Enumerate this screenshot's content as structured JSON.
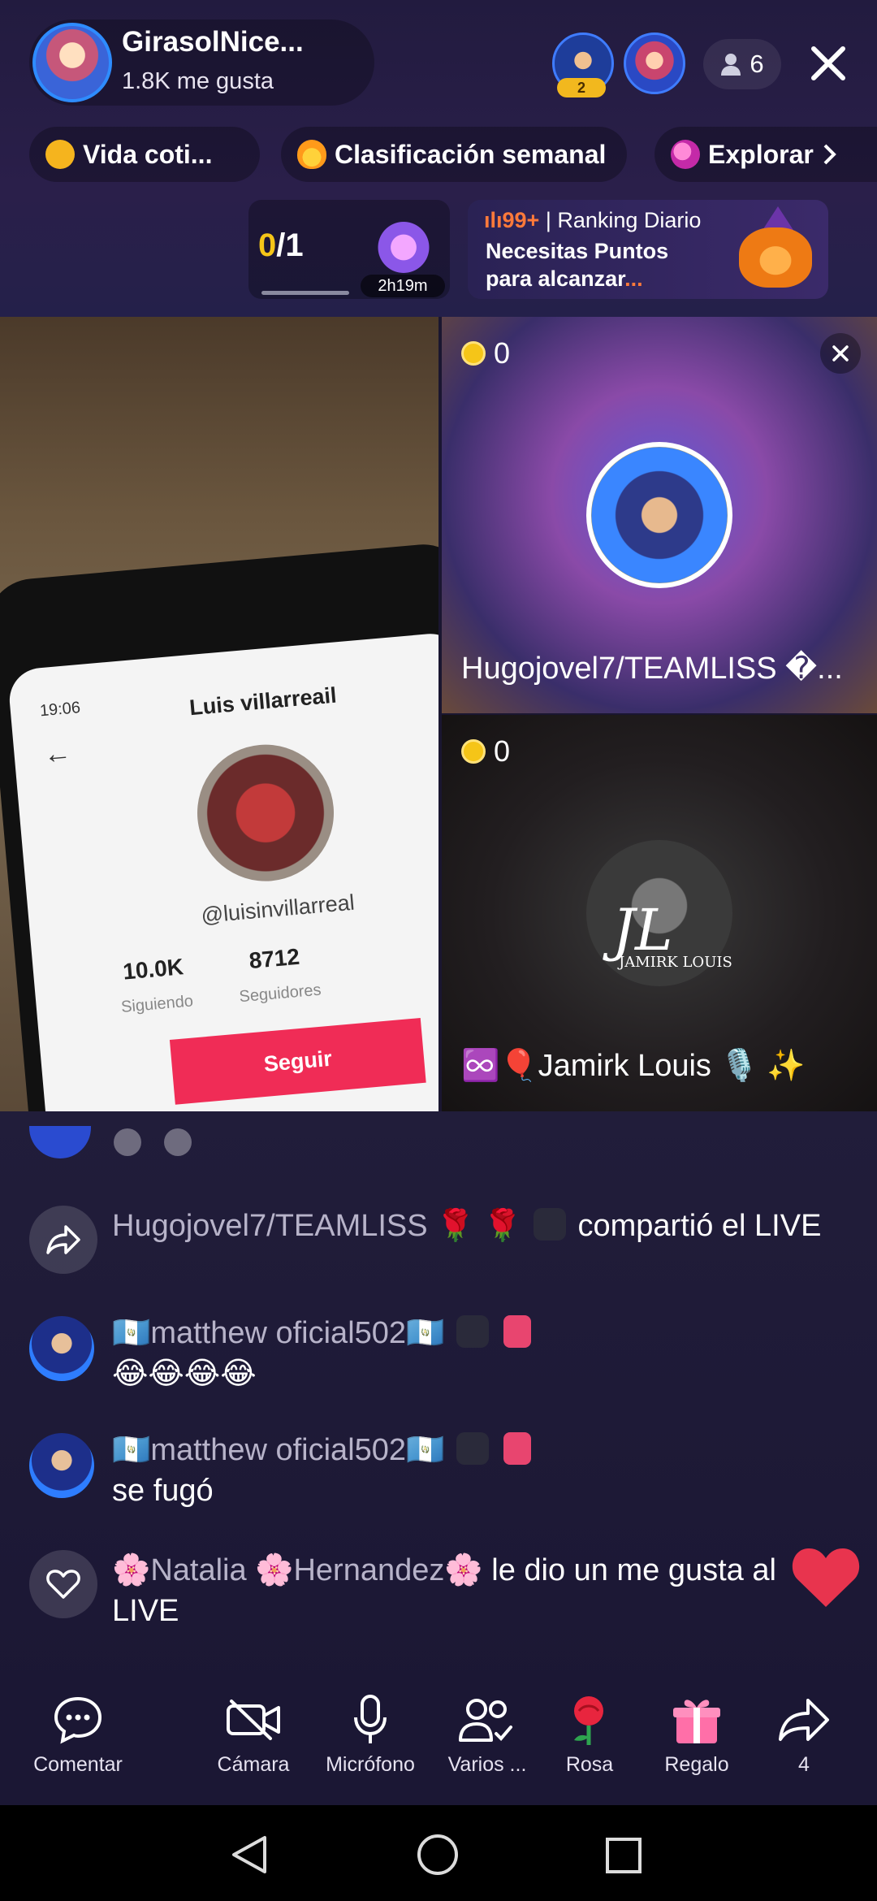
{
  "header": {
    "host_name": "GirasolNice...",
    "host_likes": "1.8K me gusta",
    "viewer_badge": "2",
    "viewer_count": "6"
  },
  "chips": [
    {
      "label": "Vida coti..."
    },
    {
      "label": "Clasificación semanal"
    },
    {
      "label": "Explorar"
    }
  ],
  "goal": {
    "current": "0",
    "total": "/1",
    "timer": "2h19m"
  },
  "ranking": {
    "badge": "99+",
    "title": "Ranking Diario",
    "line1": "Necesitas Puntos",
    "line2": "para alcanzar",
    "ellipsis": "..."
  },
  "main_video": {
    "phone_time": "19:06",
    "profile_name": "Luis villarreail",
    "profile_handle": "@luisinvillarreal",
    "following_count": "10.0K",
    "following_label": "Siguiendo",
    "followers_count": "8712",
    "followers_label": "Seguidores",
    "follow_button": "Seguir"
  },
  "cohosts": [
    {
      "name": "Hugojovel7/TEAMLISS �...",
      "score": "0"
    },
    {
      "name": "♾️🎈Jamirk Louis 🎙️ ✨",
      "score": "0",
      "logo_text": "JL",
      "logo_sub": "JAMIRK LOUIS"
    }
  ],
  "chat": [
    {
      "user": "Hugojovel7/TEAMLISS 🌹 🌹",
      "message": "compartió el LIVE",
      "type": "share"
    },
    {
      "user": "🇬🇹matthew oficial502🇬🇹",
      "message": "😂😂😂😂",
      "type": "comment"
    },
    {
      "user": "🇬🇹matthew oficial502🇬🇹",
      "message": "se fugó",
      "type": "comment"
    },
    {
      "user": "🌸Natalia 🌸Hernandez🌸",
      "message": "le dio un me gusta al LIVE",
      "type": "like"
    }
  ],
  "toolbar": {
    "comment": "Comentar",
    "camera": "Cámara",
    "mic": "Micrófono",
    "multi": "Varios ...",
    "rose": "Rosa",
    "gift": "Regalo",
    "share_count": "4"
  },
  "colors": {
    "accent_yellow": "#f5c518",
    "accent_orange": "#ff7a3a",
    "follow_red": "#f02c56"
  }
}
